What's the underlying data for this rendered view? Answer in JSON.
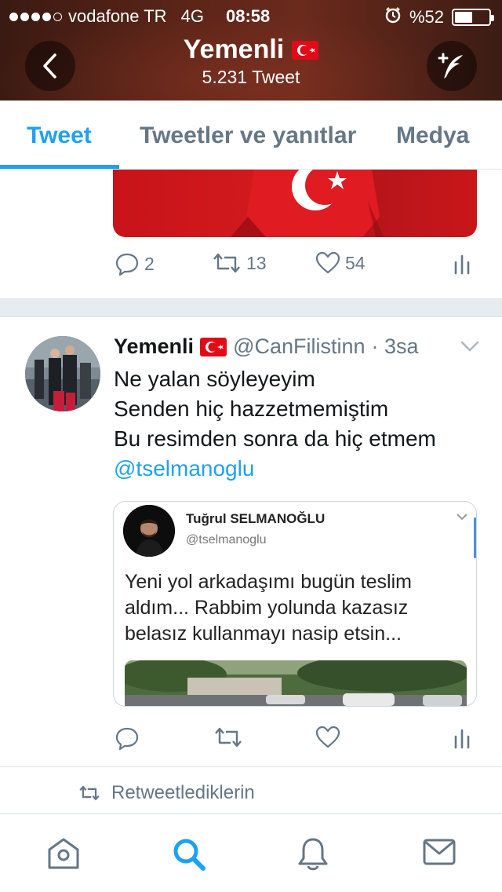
{
  "status_bar": {
    "carrier": "vodafone TR",
    "network": "4G",
    "time": "08:58",
    "battery": "%52",
    "battery_level": 0.52,
    "signal_bars_filled": 4
  },
  "header": {
    "name": "Yemenli",
    "tweet_count": "5.231 Tweet"
  },
  "tabs": [
    {
      "label": "Tweet",
      "active": true
    },
    {
      "label": "Tweetler ve yanıtlar",
      "active": false
    },
    {
      "label": "Medya",
      "active": false
    }
  ],
  "previous_tweet": {
    "replies": "2",
    "retweets": "13",
    "likes": "54"
  },
  "tweet": {
    "author_name": "Yemenli",
    "handle": "@CanFilistinn",
    "time": "· 3sa",
    "lines": [
      "Ne yalan söyleyeyim",
      "Senden hiç hazzetmemiştim",
      "Bu resimden sonra da hiç etmem"
    ],
    "mention": "@tselmanoglu",
    "quoted": {
      "name": "Tuğrul SELMANOĞLU",
      "handle": "@tselmanoglu",
      "lines": [
        "Yeni yol arkadaşımı bugün teslim",
        "aldım... Rabbim yolunda kazasız",
        "belasız kullanmayı nasip etsin..."
      ]
    }
  },
  "retweeted_label": "Retweetlediklerin",
  "colors": {
    "accent": "#1da1f2",
    "muted": "#657786",
    "flag_red": "#e30a17"
  }
}
